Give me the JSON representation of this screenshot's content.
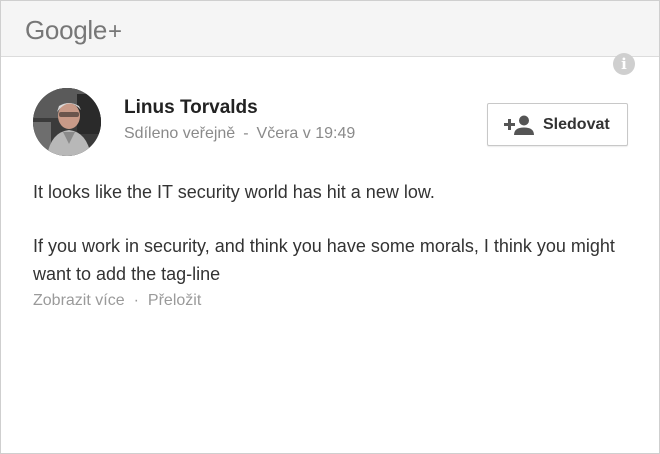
{
  "header": {
    "logo_text": "Google",
    "logo_plus": "+"
  },
  "info_icon": {
    "icon": "info-icon",
    "glyph": "i"
  },
  "post": {
    "author": "Linus Torvalds",
    "visibility": "Sdíleno veřejně",
    "separator": "-",
    "time": "Včera v 19:49",
    "follow_label": "Sledovat",
    "follow_icon": "add-person-icon",
    "paragraph1": "It looks like the IT security world has hit a new low.",
    "paragraph2": "If you work in security, and think you have some morals, I think you might want to add the tag-line",
    "more_label": "Zobrazit více",
    "link_separator": "·",
    "translate_label": "Přeložit"
  },
  "colors": {
    "header_bg": "#f5f5f5",
    "muted_text": "#8a8a8a",
    "body_text": "#333333"
  }
}
